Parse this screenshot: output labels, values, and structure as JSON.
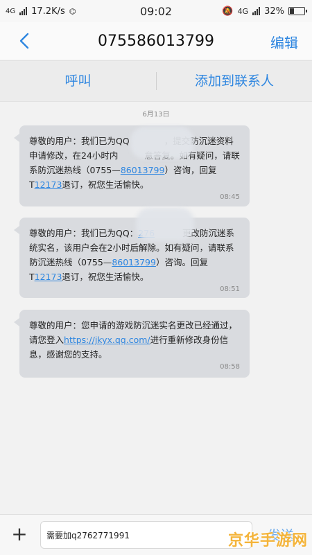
{
  "status_bar": {
    "network_left": "4G",
    "speed": "17.2K/s",
    "time": "09:02",
    "network_right": "4G",
    "battery": "32%",
    "battery_level": 0.32
  },
  "header": {
    "title": "07558601379​9",
    "edit_label": "编辑"
  },
  "actions": {
    "call_label": "呼叫",
    "add_contact_label": "添加到联系人"
  },
  "date_label": "6月13日",
  "messages": [
    {
      "t1": "尊敬的用户：我们已为QQ",
      "t2": "，提交防沉迷资料申请修改，在24小时内",
      "t3": "意答复。如有疑问，请联系防沉迷热线（0755—",
      "link1": "86013799",
      "t4": "）咨询，回复T",
      "link2": "12173",
      "t5": "退订，祝您生活愉快。",
      "time": "08:45"
    },
    {
      "t1": "尊敬的用户：我们已为QQ：",
      "link0": "276",
      "t2": "更改防沉迷系统实名，该用户会在2小时后解除。如有疑问，请联系防沉迷热线（0755—",
      "link1": "86013799",
      "t4": "）咨询。回复T",
      "link2": "12173",
      "t5": "退订，祝您生活愉快。",
      "time": "08:51"
    },
    {
      "t1": "尊敬的用户：您申请的游戏防沉迷实名更改已经通过，请您登入",
      "link1": "https://jkyx.qq.com/",
      "t2": "进行重新修改身份信息，感谢您的支持。",
      "time": "08:58"
    }
  ],
  "composer": {
    "input_value": "需要加q2762771991",
    "send_label": "发送",
    "plus_symbol": "+"
  },
  "watermark": "京华手游网",
  "colors": {
    "accent": "#2e86e0",
    "bubble": "#d9dbdf"
  }
}
